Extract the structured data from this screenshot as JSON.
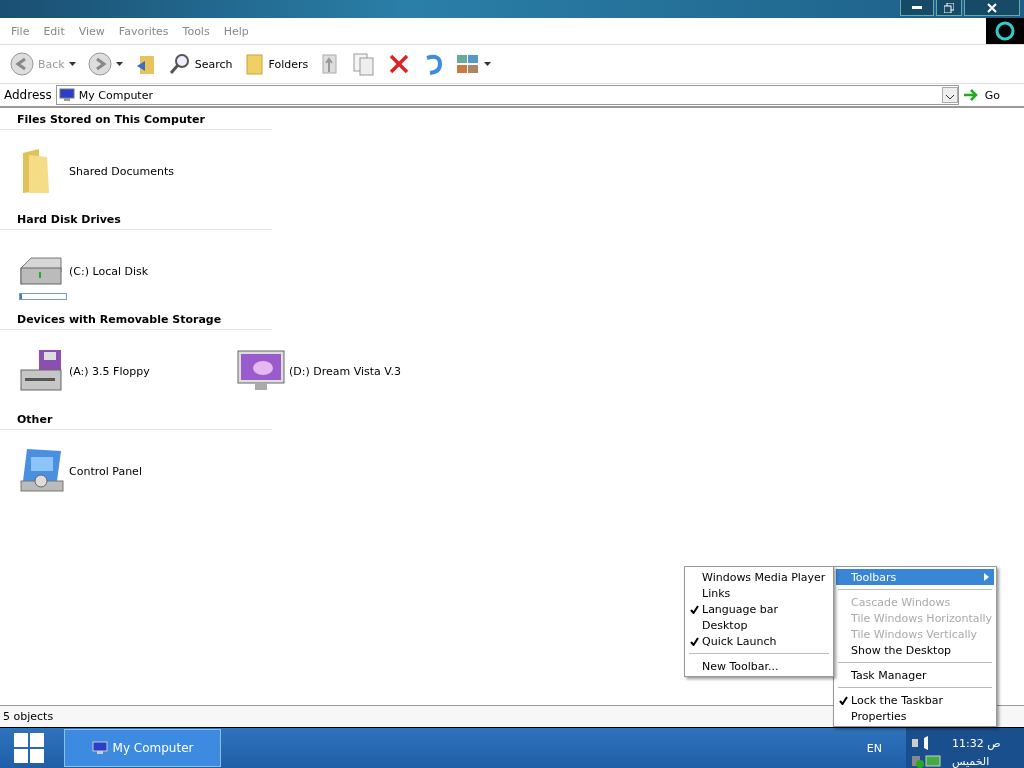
{
  "menu_bar": [
    "File",
    "Edit",
    "View",
    "Favorites",
    "Tools",
    "Help"
  ],
  "toolbar": [
    {
      "kind": "back",
      "label": "Back",
      "disabled": true,
      "dropdown": true
    },
    {
      "kind": "forward",
      "disabled": false,
      "dropdown": true
    },
    {
      "kind": "up"
    },
    {
      "kind": "search",
      "label": "Search"
    },
    {
      "kind": "folders",
      "label": "Folders"
    },
    {
      "kind": "move"
    },
    {
      "kind": "copy"
    },
    {
      "kind": "delete"
    },
    {
      "kind": "undo"
    },
    {
      "kind": "views",
      "dropdown": true
    }
  ],
  "address": {
    "label": "Address",
    "value": "My Computer",
    "go": "Go"
  },
  "groups": [
    {
      "title": "Files Stored on This Computer",
      "items": [
        {
          "kind": "folder",
          "name": "Shared Documents"
        }
      ]
    },
    {
      "title": "Hard Disk Drives",
      "items": [
        {
          "kind": "disk",
          "name": "(C:) Local Disk",
          "level": 0.05
        }
      ]
    },
    {
      "title": "Devices with Removable Storage",
      "items": [
        {
          "kind": "floppy",
          "name": "(A:) 3.5 Floppy"
        },
        {
          "kind": "monitor",
          "name": "(D:) Dream Vista V.3"
        }
      ]
    },
    {
      "title": "Other",
      "items": [
        {
          "kind": "control",
          "name": "Control Panel"
        }
      ]
    }
  ],
  "status_bar": "5 objects",
  "taskbar": {
    "task": "My Computer",
    "language": "EN",
    "time": "11:32 ص",
    "day": "الخميس"
  },
  "context_menu": [
    {
      "kind": "item",
      "label": "Toolbars",
      "selected": true,
      "submenu": true,
      "disabled": false,
      "checked": false
    },
    {
      "kind": "separator"
    },
    {
      "kind": "item",
      "label": "Cascade Windows",
      "selected": false,
      "disabled": true,
      "checked": false
    },
    {
      "kind": "item",
      "label": "Tile Windows Horizontally",
      "selected": false,
      "disabled": true,
      "checked": false
    },
    {
      "kind": "item",
      "label": "Tile Windows Vertically",
      "selected": false,
      "disabled": true,
      "checked": false
    },
    {
      "kind": "item",
      "label": "Show the Desktop",
      "selected": false,
      "disabled": false,
      "checked": false
    },
    {
      "kind": "separator"
    },
    {
      "kind": "item",
      "label": "Task Manager",
      "selected": false,
      "disabled": false,
      "checked": false
    },
    {
      "kind": "separator"
    },
    {
      "kind": "item",
      "label": "Lock the Taskbar",
      "selected": false,
      "disabled": false,
      "checked": true
    },
    {
      "kind": "item",
      "label": "Properties",
      "selected": false,
      "disabled": false,
      "checked": false
    }
  ],
  "submenu": [
    {
      "kind": "item",
      "label": "Windows Media Player",
      "checked": false
    },
    {
      "kind": "item",
      "label": "Links",
      "checked": false
    },
    {
      "kind": "item",
      "label": "Language bar",
      "checked": true
    },
    {
      "kind": "item",
      "label": "Desktop",
      "checked": false
    },
    {
      "kind": "item",
      "label": "Quick Launch",
      "checked": true
    },
    {
      "kind": "separator"
    },
    {
      "kind": "item",
      "label": "New Toolbar...",
      "checked": false
    }
  ]
}
